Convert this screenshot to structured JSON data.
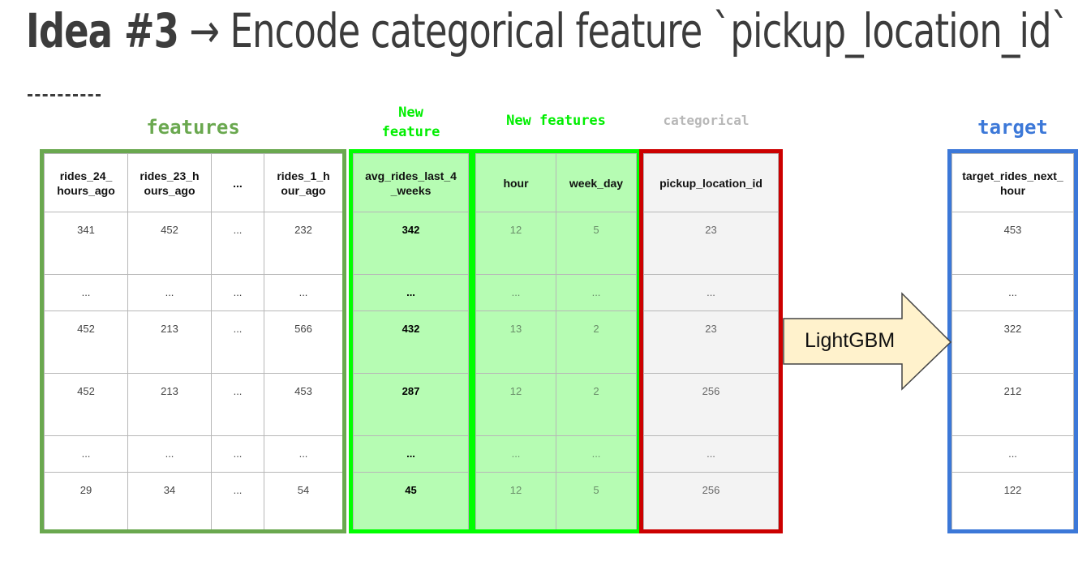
{
  "title": {
    "bold": "Idea #3",
    "rest": " → Encode categorical feature `pickup_location_id`"
  },
  "labels": {
    "features": "features",
    "new_feature": [
      "New",
      "feature"
    ],
    "new_features": "New features",
    "categorical": "categorical",
    "target": "target"
  },
  "colors": {
    "features": "#6aa84f",
    "new_feature": "#00ff00",
    "new_feature_fill": "#b6fcb3",
    "categorical": "#cc0000",
    "categorical_label": "#b7b7b7",
    "categorical_fill": "#f3f3f3",
    "target": "#3c78d8",
    "arrow_fill": "#fff2cc"
  },
  "arrow": {
    "label": "LightGBM"
  },
  "tables": {
    "features": {
      "headers": [
        "rides_24_ hours_ago",
        "rides_23_h ours_ago",
        "...",
        "rides_1_h our_ago"
      ],
      "rows": [
        [
          "341",
          "452",
          "...",
          "232"
        ],
        [
          "...",
          "...",
          "...",
          "..."
        ],
        [
          "452",
          "213",
          "...",
          "566"
        ],
        [
          "452",
          "213",
          "...",
          "453"
        ],
        [
          "...",
          "...",
          "...",
          "..."
        ],
        [
          "29",
          "34",
          "...",
          "54"
        ]
      ]
    },
    "new_feature": {
      "headers": [
        "avg_rides_last_4 _weeks"
      ],
      "rows": [
        [
          "342"
        ],
        [
          "..."
        ],
        [
          "432"
        ],
        [
          "287"
        ],
        [
          "..."
        ],
        [
          "45"
        ]
      ]
    },
    "new_features": {
      "headers": [
        "hour",
        "week_day"
      ],
      "rows": [
        [
          "12",
          "5"
        ],
        [
          "...",
          "..."
        ],
        [
          "13",
          "2"
        ],
        [
          "12",
          "2"
        ],
        [
          "...",
          "..."
        ],
        [
          "12",
          "5"
        ]
      ]
    },
    "categorical": {
      "headers": [
        "pickup_location_id"
      ],
      "rows": [
        [
          "23"
        ],
        [
          "..."
        ],
        [
          "23"
        ],
        [
          "256"
        ],
        [
          "..."
        ],
        [
          "256"
        ]
      ]
    },
    "target": {
      "headers": [
        "target_rides_next_ hour"
      ],
      "rows": [
        [
          "453"
        ],
        [
          "..."
        ],
        [
          "322"
        ],
        [
          "212"
        ],
        [
          "..."
        ],
        [
          "122"
        ]
      ]
    }
  }
}
